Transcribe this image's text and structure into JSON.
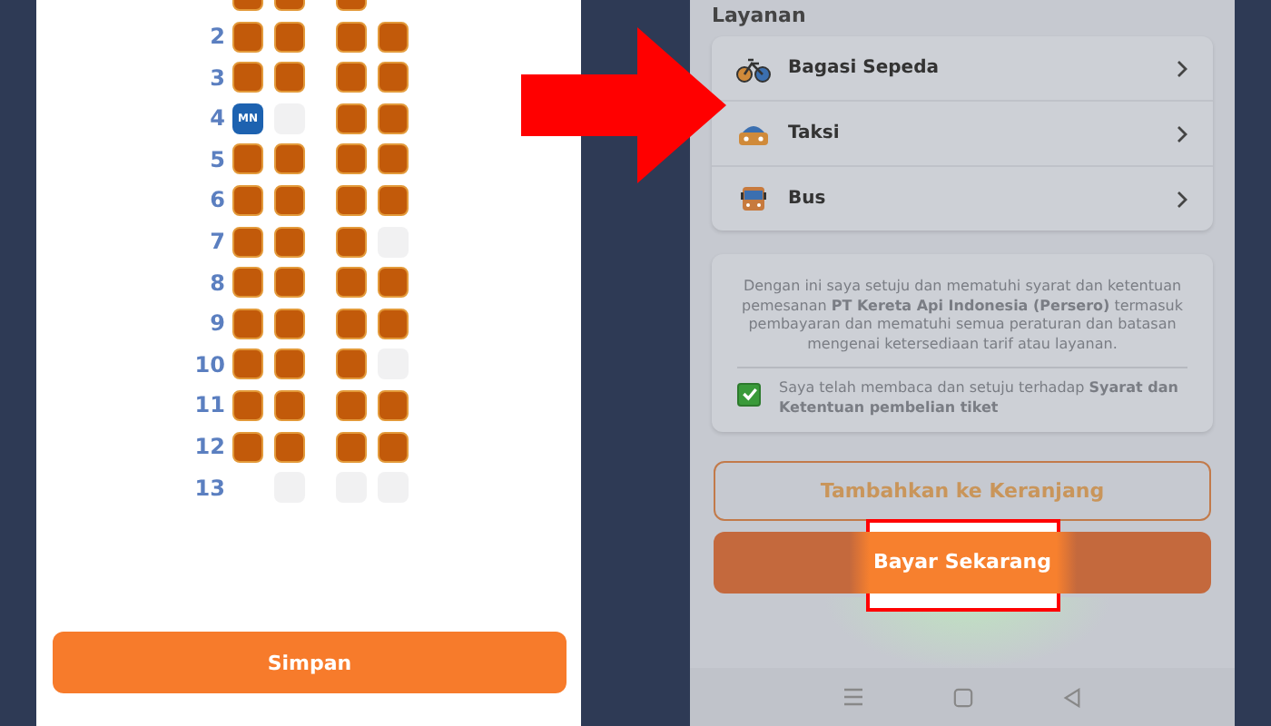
{
  "seat_map": {
    "rows": [
      {
        "seats": [
          {
            "kind": "seat",
            "available": false,
            "selected": false
          },
          {
            "kind": "seat",
            "available": false,
            "selected": false
          },
          {
            "kind": "seat",
            "available": false,
            "selected": false
          },
          {
            "kind": "gap"
          }
        ]
      },
      {
        "number": "2",
        "seats": [
          {
            "kind": "seat",
            "available": false,
            "selected": false
          },
          {
            "kind": "seat",
            "available": false,
            "selected": false
          },
          {
            "kind": "seat",
            "available": false,
            "selected": false
          },
          {
            "kind": "seat",
            "available": false,
            "selected": false
          }
        ]
      },
      {
        "number": "3",
        "seats": [
          {
            "kind": "seat",
            "available": false,
            "selected": false
          },
          {
            "kind": "seat",
            "available": false,
            "selected": false
          },
          {
            "kind": "seat",
            "available": false,
            "selected": false
          },
          {
            "kind": "seat",
            "available": false,
            "selected": false
          }
        ]
      },
      {
        "number": "4",
        "seats": [
          {
            "kind": "seat",
            "selected": true,
            "label": "MN"
          },
          {
            "kind": "seat",
            "available": true,
            "selected": false
          },
          {
            "kind": "seat",
            "available": false,
            "selected": false
          },
          {
            "kind": "seat",
            "available": false,
            "selected": false
          }
        ]
      },
      {
        "number": "5",
        "seats": [
          {
            "kind": "seat",
            "available": false,
            "selected": false
          },
          {
            "kind": "seat",
            "available": false,
            "selected": false
          },
          {
            "kind": "seat",
            "available": false,
            "selected": false
          },
          {
            "kind": "seat",
            "available": false,
            "selected": false
          }
        ]
      },
      {
        "number": "6",
        "seats": [
          {
            "kind": "seat",
            "available": false,
            "selected": false
          },
          {
            "kind": "seat",
            "available": false,
            "selected": false
          },
          {
            "kind": "seat",
            "available": false,
            "selected": false
          },
          {
            "kind": "seat",
            "available": false,
            "selected": false
          }
        ]
      },
      {
        "number": "7",
        "seats": [
          {
            "kind": "seat",
            "available": false,
            "selected": false
          },
          {
            "kind": "seat",
            "available": false,
            "selected": false
          },
          {
            "kind": "seat",
            "available": false,
            "selected": false
          },
          {
            "kind": "seat",
            "available": true,
            "selected": false
          }
        ]
      },
      {
        "number": "8",
        "seats": [
          {
            "kind": "seat",
            "available": false,
            "selected": false
          },
          {
            "kind": "seat",
            "available": false,
            "selected": false
          },
          {
            "kind": "seat",
            "available": false,
            "selected": false
          },
          {
            "kind": "seat",
            "available": false,
            "selected": false
          }
        ]
      },
      {
        "number": "9",
        "seats": [
          {
            "kind": "seat",
            "available": false,
            "selected": false
          },
          {
            "kind": "seat",
            "available": false,
            "selected": false
          },
          {
            "kind": "seat",
            "available": false,
            "selected": false
          },
          {
            "kind": "seat",
            "available": false,
            "selected": false
          }
        ]
      },
      {
        "number": "10",
        "seats": [
          {
            "kind": "seat",
            "available": false,
            "selected": false
          },
          {
            "kind": "seat",
            "available": false,
            "selected": false
          },
          {
            "kind": "seat",
            "available": false,
            "selected": false
          },
          {
            "kind": "seat",
            "available": true,
            "selected": false
          }
        ]
      },
      {
        "number": "11",
        "seats": [
          {
            "kind": "seat",
            "available": false,
            "selected": false
          },
          {
            "kind": "seat",
            "available": false,
            "selected": false
          },
          {
            "kind": "seat",
            "available": false,
            "selected": false
          },
          {
            "kind": "seat",
            "available": false,
            "selected": false
          }
        ]
      },
      {
        "number": "12",
        "seats": [
          {
            "kind": "seat",
            "available": false,
            "selected": false
          },
          {
            "kind": "seat",
            "available": false,
            "selected": false
          },
          {
            "kind": "seat",
            "available": false,
            "selected": false
          },
          {
            "kind": "seat",
            "available": false,
            "selected": false
          }
        ]
      },
      {
        "number": "13",
        "seats": [
          {
            "kind": "gap"
          },
          {
            "kind": "seat",
            "available": true,
            "selected": false
          },
          {
            "kind": "seat",
            "available": true,
            "selected": false
          },
          {
            "kind": "seat",
            "available": true,
            "selected": false
          }
        ]
      }
    ],
    "save_button": "Simpan"
  },
  "services": {
    "title": "Layanan",
    "items": [
      {
        "kind": "bicycle",
        "label": "Bagasi Sepeda"
      },
      {
        "kind": "taxi",
        "label": "Taksi"
      },
      {
        "kind": "bus",
        "label": "Bus"
      }
    ]
  },
  "consent": {
    "statement": "Dengan ini saya setuju dan mematuhi syarat dan ketentuan pemesanan **PT Kereta Api Indonesia (Persero)** termasuk pembayaran dan mematuhi semua peraturan dan batasan mengenai ketersediaan tarif atau layanan.",
    "checked": true,
    "agreement": "Saya telah membaca dan setuju terhadap **Syarat dan Ketentuan pembelian tiket**"
  },
  "cart_button": "Tambahkan ke Keranjang",
  "pay_button": {
    "label": "Bayar Sekarang",
    "highlighted": true
  }
}
